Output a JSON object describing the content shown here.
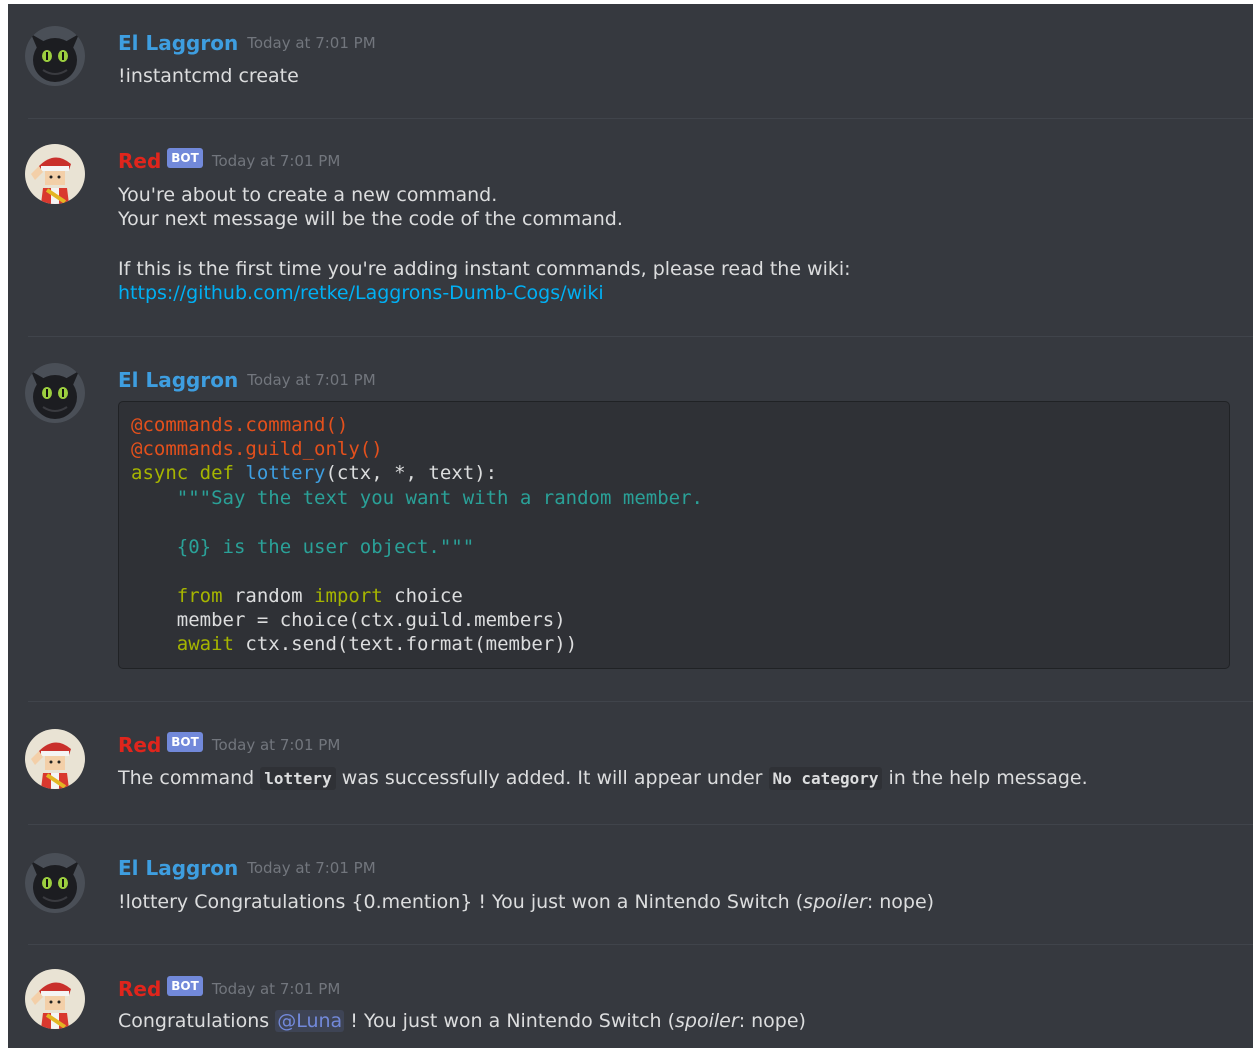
{
  "colors": {
    "background": "#36393f",
    "user_name": "#3e9ee0",
    "bot_name": "#e0251c",
    "bot_tag": "#7289da",
    "timestamp": "#72767d",
    "text": "#dcddde",
    "link": "#00b0f4",
    "code_decorator": "#e4501c",
    "code_keyword": "#a6b500",
    "code_function": "#3e9ee0",
    "code_string": "#2aa198"
  },
  "users": {
    "laggron": {
      "name": "El Laggron",
      "avatar_icon": "toothless-avatar-icon"
    },
    "red": {
      "name": "Red",
      "tag": "BOT",
      "avatar_icon": "trainer-avatar-icon"
    }
  },
  "messages": [
    {
      "author": "El Laggron",
      "timestamp": "Today at 7:01 PM",
      "text": "!instantcmd create"
    },
    {
      "author": "Red",
      "tag": "BOT",
      "timestamp": "Today at 7:01 PM",
      "lines": [
        "You're about to create a new command.",
        "Your next message will be the code of the command.",
        "If this is the first time you're adding instant commands, please read the wiki:"
      ],
      "link": "https://github.com/retke/Laggrons-Dumb-Cogs/wiki"
    },
    {
      "author": "El Laggron",
      "timestamp": "Today at 7:01 PM",
      "code": {
        "l1": "@commands.command()",
        "l2": "@commands.guild_only()",
        "l3_kw": "async def",
        "l3_fn": "lottery",
        "l3_rest": "(ctx, *, text):",
        "l4": "    \"\"\"Say the text you want with a random member.",
        "l5": "    {0} is the user object.\"\"\"",
        "l6_kw1": "from",
        "l6_mod": "random",
        "l6_kw2": "import",
        "l6_name": "choice",
        "l7": "    member = choice(ctx.guild.members)",
        "l8_kw": "await",
        "l8_rest": "ctx.send(text.format(member))"
      }
    },
    {
      "author": "Red",
      "tag": "BOT",
      "timestamp": "Today at 7:01 PM",
      "text_pre": "The command",
      "code1": "lottery",
      "text_mid": "was successfully added. It will appear under",
      "code2": "No category",
      "text_post": "in the help message."
    },
    {
      "author": "El Laggron",
      "timestamp": "Today at 7:01 PM",
      "text_pre": "!lottery Congratulations {0.mention} ! You just won a Nintendo Switch (",
      "italic": "spoiler",
      "text_post": ": nope)"
    },
    {
      "author": "Red",
      "tag": "BOT",
      "timestamp": "Today at 7:01 PM",
      "text_pre": "Congratulations",
      "mention": "@Luna",
      "text_mid": "! You just won a Nintendo Switch (",
      "italic": "spoiler",
      "text_post": ": nope)"
    }
  ]
}
